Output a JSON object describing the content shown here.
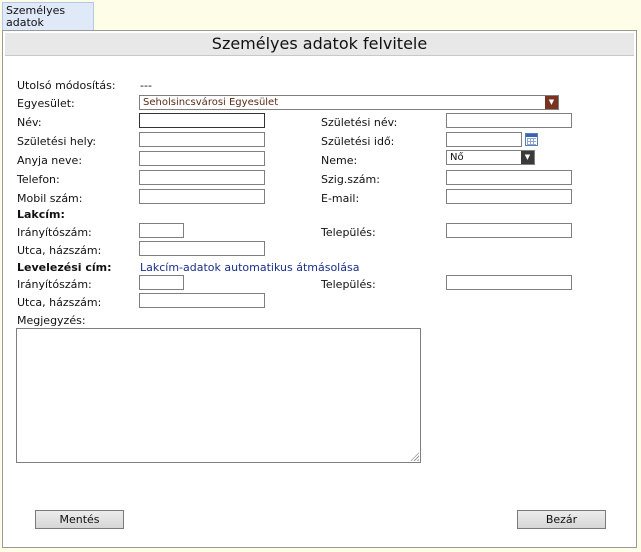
{
  "tab": {
    "label_line1": "Személyes",
    "label_line2": "adatok"
  },
  "title": "Személyes adatok felvitele",
  "last_modified": {
    "label": "Utolsó módosítás:",
    "value": "---"
  },
  "association": {
    "label": "Egyesület:",
    "value": "Seholsincsvárosi Egyesület"
  },
  "fields": {
    "name": {
      "label": "Név:",
      "value": ""
    },
    "birth_name": {
      "label": "Születési név:",
      "value": ""
    },
    "birth_place": {
      "label": "Születési hely:",
      "value": ""
    },
    "birth_date": {
      "label": "Születési idő:",
      "value": ""
    },
    "mother_name": {
      "label": "Anyja neve:",
      "value": ""
    },
    "gender": {
      "label": "Neme:",
      "value": "Nő"
    },
    "phone": {
      "label": "Telefon:",
      "value": ""
    },
    "id_number": {
      "label": "Szig.szám:",
      "value": ""
    },
    "mobile": {
      "label": "Mobil szám:",
      "value": ""
    },
    "email": {
      "label": "E-mail:",
      "value": ""
    }
  },
  "address": {
    "heading": "Lakcím:",
    "zip_label": "Irányítószám:",
    "city_label": "Település:",
    "street_label": "Utca, házszám:"
  },
  "mailing": {
    "heading": "Levelezési cím:",
    "copy_link": "Lakcím-adatok automatikus átmásolása",
    "zip_label": "Irányítószám:",
    "city_label": "Település:",
    "street_label": "Utca, házszám:"
  },
  "notes": {
    "label": "Megjegyzés:",
    "value": ""
  },
  "buttons": {
    "save": "Mentés",
    "close": "Bezár"
  },
  "colors": {
    "select_arrow_accent": "#7a3320",
    "link": "#1a2e8c",
    "tab_bg": "#dfe9f8",
    "page_bg": "#fdfde8"
  }
}
